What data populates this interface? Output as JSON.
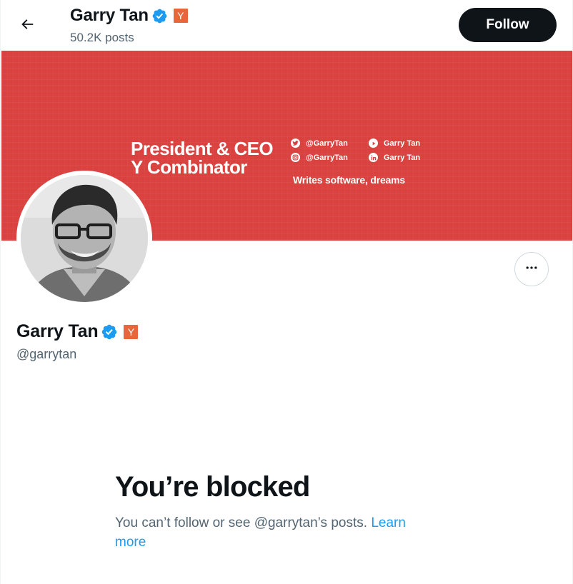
{
  "header": {
    "name": "Garry Tan",
    "badge": "Y",
    "posts_count": "50.2K posts",
    "follow_label": "Follow"
  },
  "banner": {
    "title_line1": "President & CEO",
    "title_line2": "Y Combinator",
    "social": [
      {
        "icon": "twitter-icon",
        "label": "@GarryTan"
      },
      {
        "icon": "youtube-icon",
        "label": "Garry Tan"
      },
      {
        "icon": "instagram-icon",
        "label": "@GarryTan"
      },
      {
        "icon": "linkedin-icon",
        "label": "Garry Tan"
      }
    ],
    "tagline": "Writes software, dreams"
  },
  "profile": {
    "name": "Garry Tan",
    "badge": "Y",
    "handle": "@garrytan"
  },
  "blocked": {
    "title": "You’re blocked",
    "message": "You can’t follow or see @garrytan’s posts.",
    "link_label": "Learn more"
  },
  "colors": {
    "banner": "#d9423f",
    "verified": "#1d9bf0",
    "yc_badge": "#e8673a",
    "follow_button": "#0f1419",
    "link": "#1d9bf0"
  }
}
